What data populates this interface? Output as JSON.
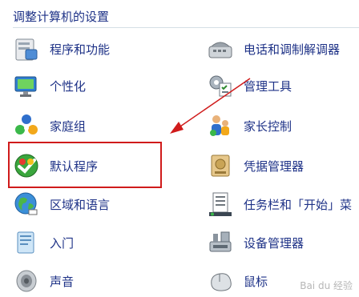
{
  "header": {
    "title": "调整计算机的设置"
  },
  "left_items": [
    {
      "label": "程序和功能",
      "icon": "programs-features-icon"
    },
    {
      "label": "个性化",
      "icon": "personalization-icon"
    },
    {
      "label": "家庭组",
      "icon": "homegroup-icon"
    },
    {
      "label": "默认程序",
      "icon": "default-programs-icon"
    },
    {
      "label": "区域和语言",
      "icon": "region-language-icon"
    },
    {
      "label": "入门",
      "icon": "getting-started-icon"
    },
    {
      "label": "声音",
      "icon": "sound-icon"
    }
  ],
  "right_items": [
    {
      "label": "电话和调制解调器",
      "icon": "phone-modem-icon"
    },
    {
      "label": "管理工具",
      "icon": "admin-tools-icon"
    },
    {
      "label": "家长控制",
      "icon": "parental-controls-icon"
    },
    {
      "label": "凭据管理器",
      "icon": "credential-manager-icon"
    },
    {
      "label": "任务栏和「开始」菜",
      "icon": "taskbar-start-menu-icon"
    },
    {
      "label": "设备管理器",
      "icon": "device-manager-icon"
    },
    {
      "label": "鼠标",
      "icon": "mouse-icon"
    }
  ],
  "colors": {
    "link": "#1e3287",
    "highlight": "#d01b1b",
    "background": "#ffffff"
  },
  "watermark": "Bai du 经验"
}
